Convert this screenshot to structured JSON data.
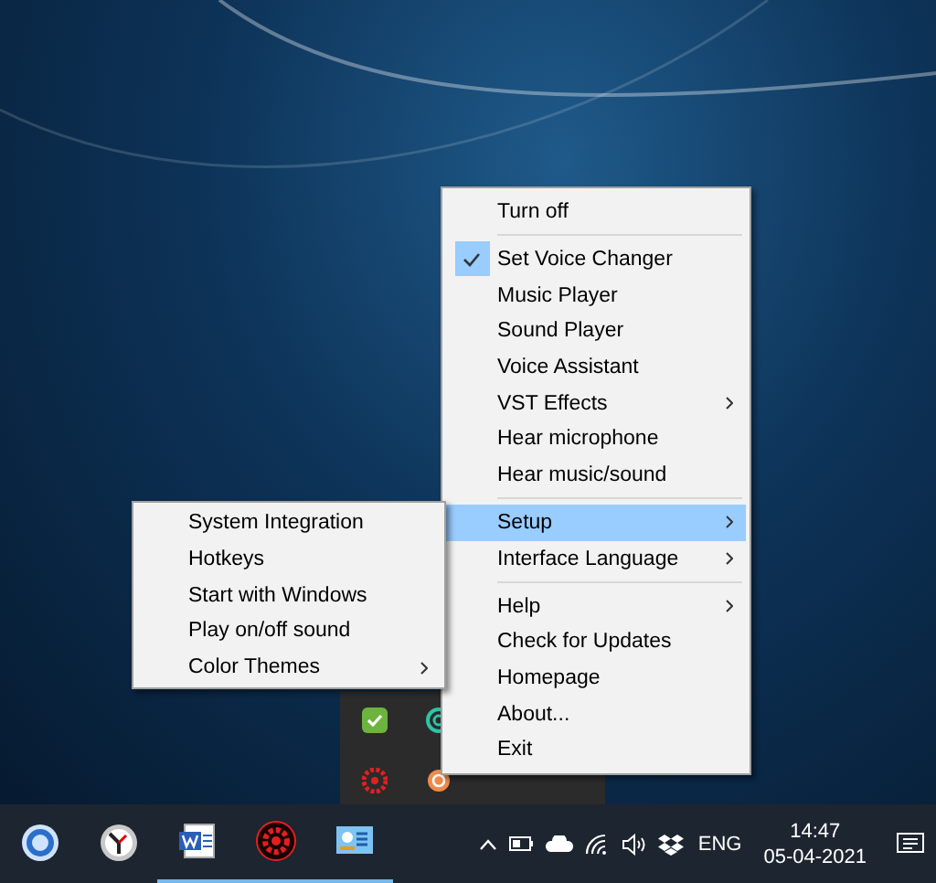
{
  "context_menu": {
    "items": [
      {
        "kind": "item",
        "label": "Turn off",
        "checked": false,
        "selected": false,
        "submenu": false
      },
      {
        "kind": "separator"
      },
      {
        "kind": "item",
        "label": "Set Voice Changer",
        "checked": true,
        "selected": false,
        "submenu": false
      },
      {
        "kind": "item",
        "label": "Music Player",
        "checked": false,
        "selected": false,
        "submenu": false
      },
      {
        "kind": "item",
        "label": "Sound Player",
        "checked": false,
        "selected": false,
        "submenu": false
      },
      {
        "kind": "item",
        "label": "Voice Assistant",
        "checked": false,
        "selected": false,
        "submenu": false
      },
      {
        "kind": "item",
        "label": "VST Effects",
        "checked": false,
        "selected": false,
        "submenu": true
      },
      {
        "kind": "item",
        "label": "Hear microphone",
        "checked": false,
        "selected": false,
        "submenu": false
      },
      {
        "kind": "item",
        "label": "Hear music/sound",
        "checked": false,
        "selected": false,
        "submenu": false
      },
      {
        "kind": "separator"
      },
      {
        "kind": "item",
        "label": "Setup",
        "checked": false,
        "selected": true,
        "submenu": true
      },
      {
        "kind": "item",
        "label": "Interface Language",
        "checked": false,
        "selected": false,
        "submenu": true
      },
      {
        "kind": "separator"
      },
      {
        "kind": "item",
        "label": "Help",
        "checked": false,
        "selected": false,
        "submenu": true
      },
      {
        "kind": "item",
        "label": "Check for Updates",
        "checked": false,
        "selected": false,
        "submenu": false
      },
      {
        "kind": "item",
        "label": "Homepage",
        "checked": false,
        "selected": false,
        "submenu": false
      },
      {
        "kind": "item",
        "label": "About...",
        "checked": false,
        "selected": false,
        "submenu": false
      },
      {
        "kind": "item",
        "label": "Exit",
        "checked": false,
        "selected": false,
        "submenu": false
      }
    ]
  },
  "setup_submenu": {
    "items": [
      {
        "kind": "item",
        "label": "System Integration",
        "checked": false,
        "selected": false,
        "submenu": false
      },
      {
        "kind": "item",
        "label": "Hotkeys",
        "checked": false,
        "selected": false,
        "submenu": false
      },
      {
        "kind": "item",
        "label": "Start with Windows",
        "checked": false,
        "selected": false,
        "submenu": false
      },
      {
        "kind": "item",
        "label": "Play on/off sound",
        "checked": false,
        "selected": false,
        "submenu": false
      },
      {
        "kind": "item",
        "label": "Color Themes",
        "checked": false,
        "selected": false,
        "submenu": true
      }
    ]
  },
  "taskbar": {
    "apps": [
      {
        "running": false
      },
      {
        "running": false
      },
      {
        "running": true
      },
      {
        "running": true
      },
      {
        "running": true
      }
    ],
    "tray": {
      "language": "ENG",
      "time": "14:47",
      "date": "05-04-2021"
    }
  }
}
